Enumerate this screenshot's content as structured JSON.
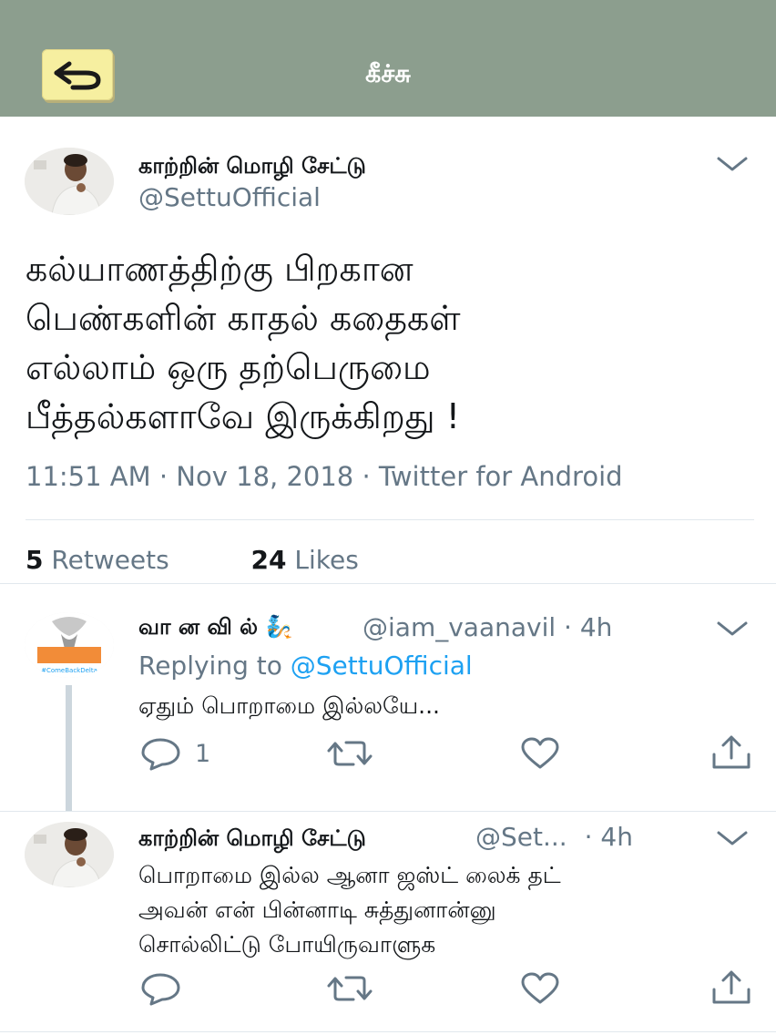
{
  "header": {
    "title": "கீச்சு",
    "back_icon": "back-arrow-icon"
  },
  "tweet": {
    "author_name": "காற்றின் மொழி சேட்டு",
    "author_handle": "@SettuOfficial",
    "text_lines": [
      "கல்யாணத்திற்கு பிறகான",
      "பெண்களின் காதல் கதைகள்",
      "எல்லாம் ஒரு தற்பெருமை",
      "பீத்தல்களாவே இருக்கிறது !"
    ],
    "meta": "11:51 AM · Nov 18, 2018 · Twitter for Android",
    "retweets_count": "5",
    "retweets_label": "Retweets",
    "likes_count": "24",
    "likes_label": "Likes"
  },
  "replies": [
    {
      "name": "வா ன வி ல்",
      "emoji": "🧞",
      "handle": "@iam_vaanavil",
      "time": "· 4h",
      "replying_prefix": "Replying to",
      "replying_to": "@SettuOfficial",
      "text_lines": [
        "ஏதும் பொறாமை இல்லயே..."
      ],
      "reply_count": "1"
    },
    {
      "name": "காற்றின் மொழி சேட்டு",
      "handle": "@Set...",
      "time": "· 4h",
      "text_lines": [
        "பொறாமை இல்ல ஆனா ஜஸ்ட் லைக் தட்",
        "அவன் என் பின்னாடி சுத்துனான்னு",
        "சொல்லிட்டு போயிருவாளுக"
      ],
      "reply_count": ""
    }
  ],
  "colors": {
    "header_bg": "#8c9e8e",
    "back_button_bg": "#f6efa0",
    "link_blue": "#1da1f2",
    "secondary_text": "#657786"
  }
}
